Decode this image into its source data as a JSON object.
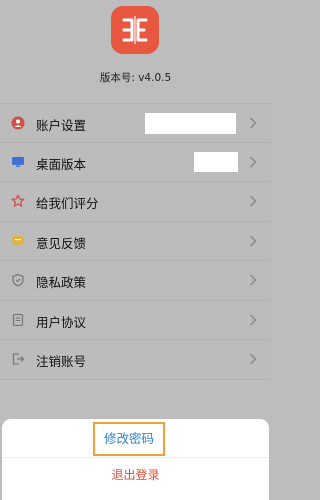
{
  "app": {
    "version": "版本号: v4.0.5"
  },
  "menu": {
    "items": [
      {
        "label": "账户设置",
        "icon": "user-icon"
      },
      {
        "label": "桌面版本",
        "icon": "monitor-icon"
      },
      {
        "label": "给我们评分",
        "icon": "star-icon"
      },
      {
        "label": "意见反馈",
        "icon": "feedback-icon"
      },
      {
        "label": "隐私政策",
        "icon": "shield-icon"
      },
      {
        "label": "用户协议",
        "icon": "document-icon"
      },
      {
        "label": "注销账号",
        "icon": "logout-icon"
      }
    ]
  },
  "sheet": {
    "change_password": "修改密码",
    "logout": "退出登录"
  },
  "colors": {
    "brand": "#e8573f",
    "link": "#2e82ca",
    "highlight": "#f3a03a",
    "danger": "#e0503a"
  }
}
